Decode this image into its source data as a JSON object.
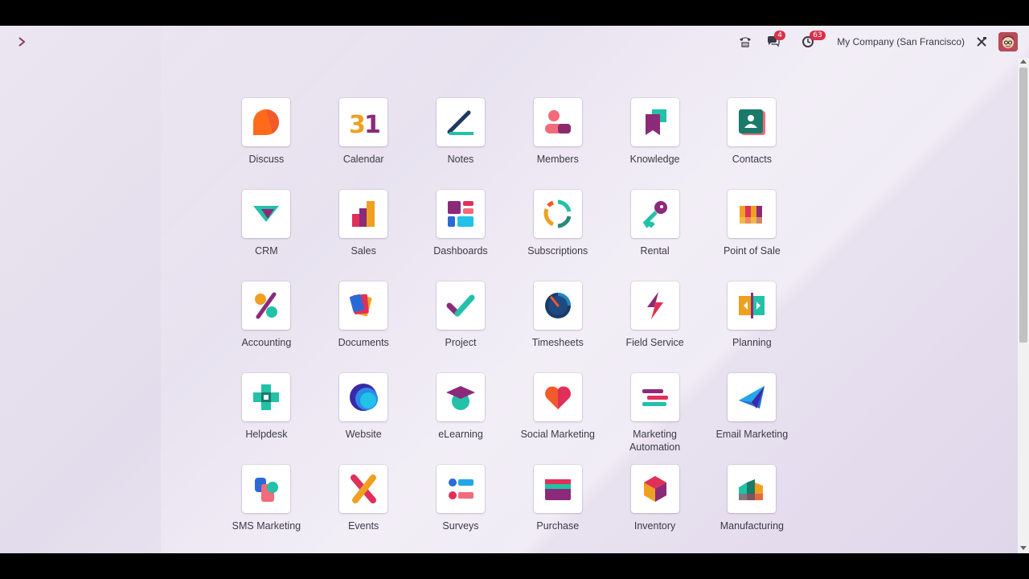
{
  "navbar": {
    "phone_icon": "phone-icon",
    "messages_badge": "4",
    "activities_badge": "63",
    "company": "My Company (San Francisco)"
  },
  "apps": [
    {
      "label": "Discuss",
      "icon": "discuss-icon"
    },
    {
      "label": "Calendar",
      "icon": "calendar-icon"
    },
    {
      "label": "Notes",
      "icon": "notes-icon"
    },
    {
      "label": "Members",
      "icon": "members-icon"
    },
    {
      "label": "Knowledge",
      "icon": "knowledge-icon"
    },
    {
      "label": "Contacts",
      "icon": "contacts-icon"
    },
    {
      "label": "CRM",
      "icon": "crm-icon"
    },
    {
      "label": "Sales",
      "icon": "sales-icon"
    },
    {
      "label": "Dashboards",
      "icon": "dashboards-icon"
    },
    {
      "label": "Subscriptions",
      "icon": "subscriptions-icon"
    },
    {
      "label": "Rental",
      "icon": "rental-icon"
    },
    {
      "label": "Point of Sale",
      "icon": "point-of-sale-icon"
    },
    {
      "label": "Accounting",
      "icon": "accounting-icon"
    },
    {
      "label": "Documents",
      "icon": "documents-icon"
    },
    {
      "label": "Project",
      "icon": "project-icon"
    },
    {
      "label": "Timesheets",
      "icon": "timesheets-icon"
    },
    {
      "label": "Field Service",
      "icon": "field-service-icon"
    },
    {
      "label": "Planning",
      "icon": "planning-icon"
    },
    {
      "label": "Helpdesk",
      "icon": "helpdesk-icon"
    },
    {
      "label": "Website",
      "icon": "website-icon"
    },
    {
      "label": "eLearning",
      "icon": "elearning-icon"
    },
    {
      "label": "Social Marketing",
      "icon": "social-marketing-icon"
    },
    {
      "label": "Marketing Automation",
      "icon": "marketing-automation-icon"
    },
    {
      "label": "Email Marketing",
      "icon": "email-marketing-icon"
    },
    {
      "label": "SMS Marketing",
      "icon": "sms-marketing-icon"
    },
    {
      "label": "Events",
      "icon": "events-icon"
    },
    {
      "label": "Surveys",
      "icon": "surveys-icon"
    },
    {
      "label": "Purchase",
      "icon": "purchase-icon"
    },
    {
      "label": "Inventory",
      "icon": "inventory-icon"
    },
    {
      "label": "Manufacturing",
      "icon": "manufacturing-icon"
    }
  ]
}
